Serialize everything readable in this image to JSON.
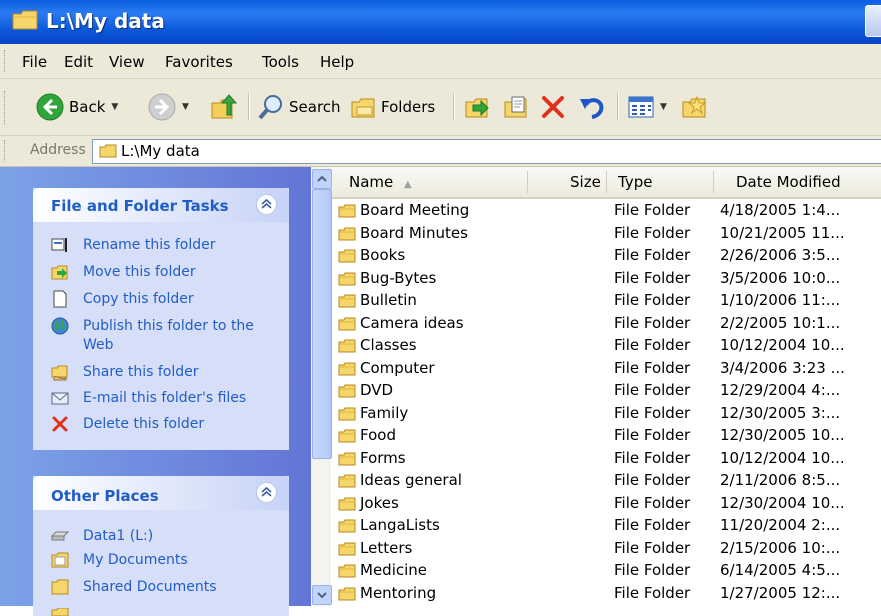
{
  "window": {
    "title": "L:\\My data"
  },
  "menu": [
    "File",
    "Edit",
    "View",
    "Favorites",
    "Tools",
    "Help"
  ],
  "toolbar": {
    "back_label": "Back",
    "search_label": "Search",
    "folders_label": "Folders"
  },
  "address": {
    "label": "Address",
    "value": "L:\\My data"
  },
  "tasks": {
    "title": "File and Folder Tasks",
    "items": [
      {
        "label": "Rename this folder",
        "icon": "rename-icon"
      },
      {
        "label": "Move this folder",
        "icon": "move-icon"
      },
      {
        "label": "Copy this folder",
        "icon": "copy-icon"
      },
      {
        "label": "Publish this folder to the Web",
        "icon": "globe-icon"
      },
      {
        "label": "Share this folder",
        "icon": "share-icon"
      },
      {
        "label": "E-mail this folder's files",
        "icon": "email-icon"
      },
      {
        "label": "Delete this folder",
        "icon": "delete-icon"
      }
    ]
  },
  "places": {
    "title": "Other Places",
    "items": [
      {
        "label": "Data1 (L:)",
        "icon": "drive-icon"
      },
      {
        "label": "My Documents",
        "icon": "folder-icon"
      },
      {
        "label": "Shared Documents",
        "icon": "folder-icon"
      }
    ]
  },
  "columns": {
    "name": "Name",
    "size": "Size",
    "type": "Type",
    "date": "Date Modified"
  },
  "files": [
    {
      "name": "Board Meeting",
      "type": "File Folder",
      "date": "4/18/2005 1:4..."
    },
    {
      "name": "Board Minutes",
      "type": "File Folder",
      "date": "10/21/2005 11..."
    },
    {
      "name": "Books",
      "type": "File Folder",
      "date": "2/26/2006 3:5..."
    },
    {
      "name": "Bug-Bytes",
      "type": "File Folder",
      "date": "3/5/2006 10:0..."
    },
    {
      "name": "Bulletin",
      "type": "File Folder",
      "date": "1/10/2006 11:..."
    },
    {
      "name": "Camera ideas",
      "type": "File Folder",
      "date": "2/2/2005 10:1..."
    },
    {
      "name": "Classes",
      "type": "File Folder",
      "date": "10/12/2004 10..."
    },
    {
      "name": "Computer",
      "type": "File Folder",
      "date": "3/4/2006 3:23 ..."
    },
    {
      "name": "DVD",
      "type": "File Folder",
      "date": "12/29/2004 4:..."
    },
    {
      "name": "Family",
      "type": "File Folder",
      "date": "12/30/2005 3:..."
    },
    {
      "name": "Food",
      "type": "File Folder",
      "date": "12/30/2005 10..."
    },
    {
      "name": "Forms",
      "type": "File Folder",
      "date": "10/12/2004 10..."
    },
    {
      "name": "Ideas general",
      "type": "File Folder",
      "date": "2/11/2006 8:5..."
    },
    {
      "name": "Jokes",
      "type": "File Folder",
      "date": "12/30/2004 10..."
    },
    {
      "name": "LangaLists",
      "type": "File Folder",
      "date": "11/20/2004 2:..."
    },
    {
      "name": "Letters",
      "type": "File Folder",
      "date": "2/15/2006 10:..."
    },
    {
      "name": "Medicine",
      "type": "File Folder",
      "date": "6/14/2005 4:5..."
    },
    {
      "name": "Mentoring",
      "type": "File Folder",
      "date": "1/27/2005 12:..."
    }
  ]
}
